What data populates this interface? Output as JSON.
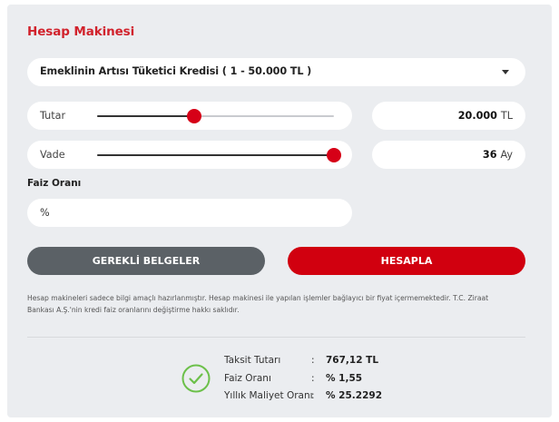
{
  "calculator": {
    "title": "Hesap Makinesi",
    "loan_type": {
      "selected": "Emeklinin Artısı Tüketici Kredisi ( 1 - 50.000 TL )"
    },
    "amount": {
      "label": "Tutar",
      "value": "20.000",
      "unit": "TL",
      "slider_fraction": 0.41
    },
    "term": {
      "label": "Vade",
      "value": "36",
      "unit": "Ay",
      "slider_fraction": 1.0
    },
    "interest": {
      "label": "Faiz Oranı",
      "placeholder": "%"
    },
    "buttons": {
      "documents": "GEREKLİ BELGELER",
      "calculate": "HESAPLA"
    },
    "disclaimer": "Hesap makineleri sadece bilgi amaçlı hazırlanmıştır. Hesap makinesi ile yapılan işlemler bağlayıcı bir fiyat içermemektedir. T.C. Ziraat Bankası A.Ş.'nin kredi faiz oranlarını değiştirme hakkı saklıdır.",
    "results": [
      {
        "label": "Taksit Tutarı",
        "separator": ":",
        "value": "767,12 TL"
      },
      {
        "label": "Faiz Oranı",
        "separator": ":",
        "value": "% 1,55"
      },
      {
        "label": "Yıllık Maliyet Oranı",
        "separator": ":",
        "value": "% 25.2292"
      }
    ],
    "icons": {
      "select_caret": "caret-down-icon",
      "result_status": "check-circle-icon"
    },
    "colors": {
      "accent_red": "#d1000f",
      "title_red": "#d1222c",
      "slider_thumb": "#d60017",
      "secondary_button": "#5b6166",
      "check_green": "#6cc04a",
      "panel_background": "#ebedf0"
    }
  }
}
